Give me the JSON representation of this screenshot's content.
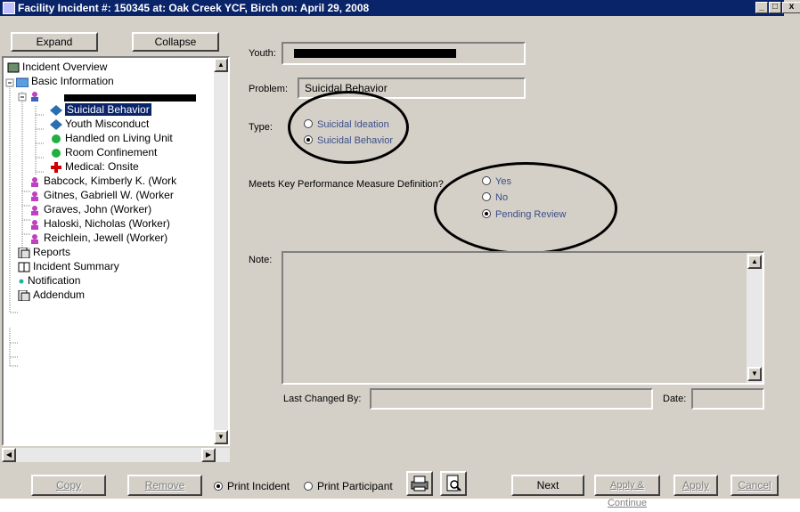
{
  "window": {
    "title": "Facility Incident #: 150345     at: Oak Creek YCF, Birch     on: April 29, 2008",
    "minimize": "_",
    "maximize": "□",
    "close": "x"
  },
  "left_panel": {
    "expand_label": "Expand",
    "collapse_label": "Collapse",
    "tree": [
      {
        "label": "Incident Overview",
        "icon": "overview-icon"
      },
      {
        "label": "Basic Information",
        "icon": "folder-icon"
      },
      {
        "label": "",
        "icon": "person-icon"
      },
      {
        "label": "Suicidal Behavior",
        "icon": "diamond-icon",
        "selected": true
      },
      {
        "label": "Youth Misconduct",
        "icon": "diamond-icon"
      },
      {
        "label": "Handled on Living Unit",
        "icon": "green-circle-icon"
      },
      {
        "label": "Room Confinement",
        "icon": "green-circle-icon"
      },
      {
        "label": "Medical: Onsite",
        "icon": "red-cross-icon"
      },
      {
        "label": "Babcock, Kimberly K.  (Work",
        "icon": "person-icon"
      },
      {
        "label": "Gitnes, Gabriell W.  (Worker",
        "icon": "person-icon"
      },
      {
        "label": "Graves, John  (Worker)",
        "icon": "person-icon"
      },
      {
        "label": "Haloski, Nicholas  (Worker)",
        "icon": "person-icon"
      },
      {
        "label": "Reichlein, Jewell  (Worker)",
        "icon": "person-icon"
      },
      {
        "label": "Reports",
        "icon": "report-icon"
      },
      {
        "label": "Incident Summary",
        "icon": "book-icon"
      },
      {
        "label": "Notification",
        "icon": "dot-icon"
      },
      {
        "label": "Addendum",
        "icon": "report-icon"
      }
    ]
  },
  "form": {
    "youth_label": "Youth:",
    "youth_value": "",
    "problem_label": "Problem:",
    "problem_value": "Suicidal Behavior",
    "type_label": "Type:",
    "type_options": [
      "Suicidal Ideation",
      "Suicidal Behavior"
    ],
    "type_selected": 1,
    "kpm_label": "Meets Key Performance Measure Definition?",
    "kpm_options": [
      "Yes",
      "No",
      "Pending Review"
    ],
    "kpm_selected": 2,
    "note_label": "Note:",
    "note_value": "",
    "last_changed_label": "Last Changed By:",
    "last_changed_value": "",
    "date_label": "Date:",
    "date_value": ""
  },
  "footer": {
    "copy_label": "Copy",
    "remove_label": "Remove",
    "print_incident_label": "Print Incident",
    "print_participant_label": "Print Participant",
    "print_selected": "incident",
    "next_label": "Next",
    "apply_continue_label": "Apply & Continue",
    "apply_label": "Apply",
    "cancel_label": "Cancel"
  }
}
